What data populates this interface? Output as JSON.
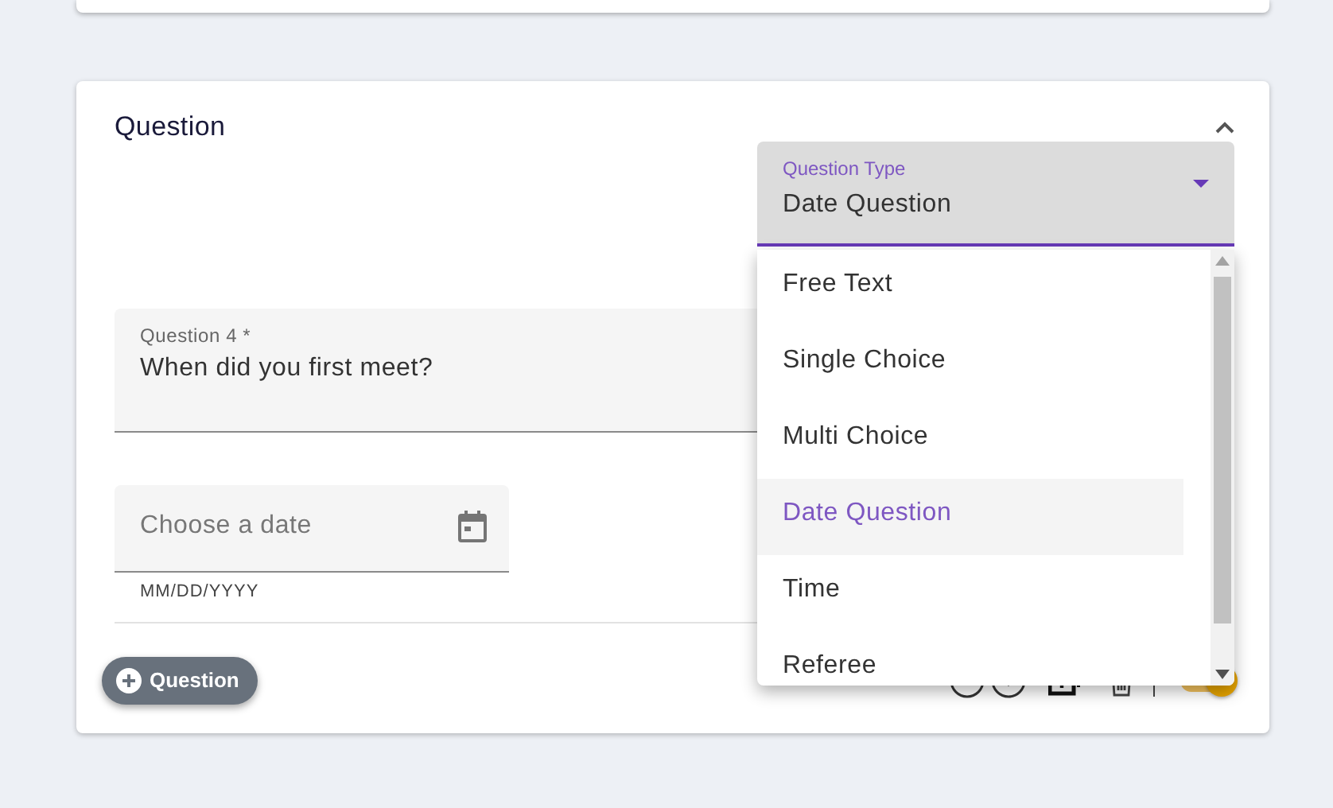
{
  "section": {
    "title": "Question",
    "expanded": true
  },
  "question_type": {
    "label": "Question Type",
    "value": "Date Question",
    "open": true,
    "options": [
      {
        "label": "Free Text",
        "selected": false
      },
      {
        "label": "Single Choice",
        "selected": false
      },
      {
        "label": "Multi Choice",
        "selected": false
      },
      {
        "label": "Date Question",
        "selected": true
      },
      {
        "label": "Time",
        "selected": false
      },
      {
        "label": "Referee",
        "selected": false
      }
    ]
  },
  "question_field": {
    "label": "Question 4 *",
    "value": "When did you first meet?"
  },
  "date_field": {
    "placeholder": "Choose a date",
    "hint": "MM/DD/YYYY"
  },
  "add_button": {
    "label": "Question"
  },
  "required": {
    "on": true
  }
}
